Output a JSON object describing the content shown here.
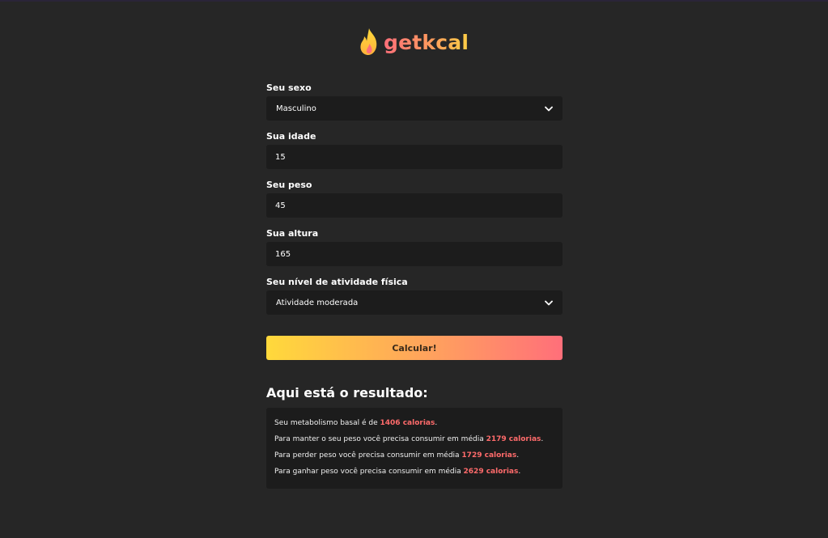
{
  "brand": {
    "name": "getkcal",
    "logo_icon": "flame-icon"
  },
  "colors": {
    "background": "#262626",
    "field_bg": "#1c1c1c",
    "accent_red": "#ff6b6b",
    "gradient_start": "#ffd93b",
    "gradient_end": "#ff6f7a"
  },
  "form": {
    "sexo": {
      "label": "Seu sexo",
      "value": "Masculino"
    },
    "idade": {
      "label": "Sua idade",
      "value": "15"
    },
    "peso": {
      "label": "Seu peso",
      "value": "45"
    },
    "altura": {
      "label": "Sua altura",
      "value": "165"
    },
    "atividade": {
      "label": "Seu nível de atividade física",
      "value": "Atividade moderada"
    },
    "submit_label": "Calcular!"
  },
  "result": {
    "title": "Aqui está o resultado:",
    "lines": [
      {
        "prefix": "Seu metabolismo basal é de ",
        "value": "1406 calorias",
        "suffix": "."
      },
      {
        "prefix": "Para manter o seu peso você precisa consumir em média ",
        "value": "2179 calorias",
        "suffix": "."
      },
      {
        "prefix": "Para perder peso você precisa consumir em média ",
        "value": "1729 calorias",
        "suffix": "."
      },
      {
        "prefix": "Para ganhar peso você precisa consumir em média ",
        "value": "2629 calorias",
        "suffix": "."
      }
    ]
  }
}
